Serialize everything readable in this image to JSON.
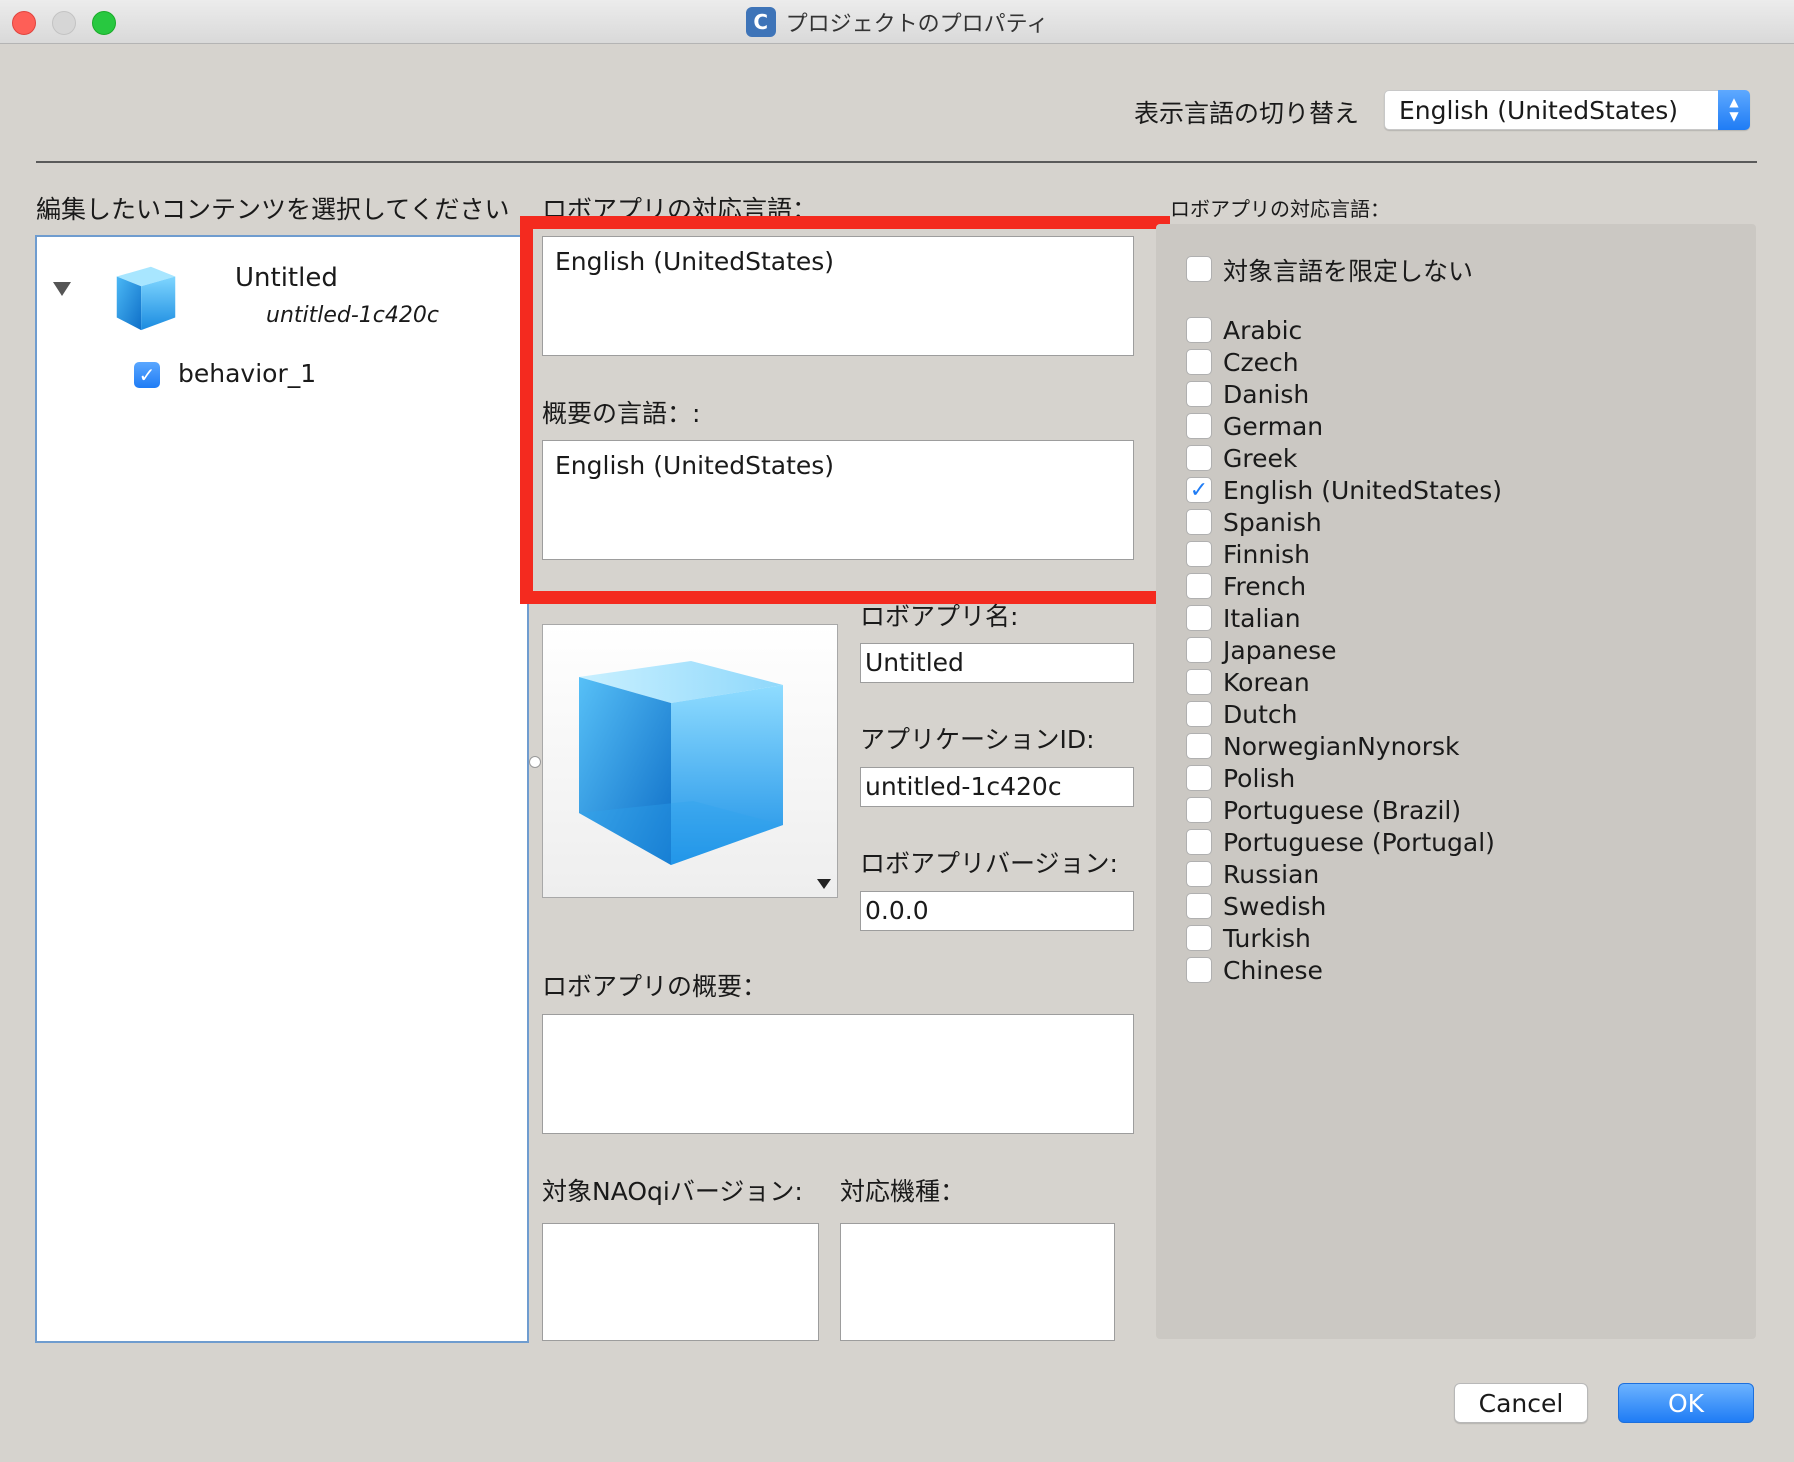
{
  "window": {
    "title": "プロジェクトのプロパティ",
    "app_icon_letter": "C"
  },
  "header": {
    "language_switch_label": "表示言語の切り替え",
    "language_switch_value": "English (UnitedStates)"
  },
  "tree": {
    "heading": "編集したいコンテンツを選択してください",
    "root_title": "Untitled",
    "root_subtitle": "untitled-1c420c",
    "child_label": "behavior_1",
    "child_checked": true
  },
  "details": {
    "supported_language_label": "ロボアプリの対応言語：",
    "supported_language_value": "English (UnitedStates)",
    "summary_language_label": "概要の言語：:",
    "summary_language_value": "English (UnitedStates)",
    "app_name_label": "ロボアプリ名:",
    "app_name_value": "Untitled",
    "app_id_label": "アプリケーションID:",
    "app_id_value": "untitled-1c420c",
    "version_label": "ロボアプリバージョン:",
    "version_value": "0.0.0",
    "description_label": "ロボアプリの概要：",
    "description_value": "",
    "naoqi_label": "対象NAOqiバージョン:",
    "naoqi_value": "",
    "models_label": "対応機種：",
    "models_value": ""
  },
  "languages": {
    "heading": "ロボアプリの対応言語：",
    "no_limit_label": "対象言語を限定しない",
    "no_limit_checked": false,
    "items": [
      {
        "label": "Arabic",
        "checked": false
      },
      {
        "label": "Czech",
        "checked": false
      },
      {
        "label": "Danish",
        "checked": false
      },
      {
        "label": "German",
        "checked": false
      },
      {
        "label": "Greek",
        "checked": false
      },
      {
        "label": "English (UnitedStates)",
        "checked": true
      },
      {
        "label": "Spanish",
        "checked": false
      },
      {
        "label": "Finnish",
        "checked": false
      },
      {
        "label": "French",
        "checked": false
      },
      {
        "label": "Italian",
        "checked": false
      },
      {
        "label": "Japanese",
        "checked": false
      },
      {
        "label": "Korean",
        "checked": false
      },
      {
        "label": "Dutch",
        "checked": false
      },
      {
        "label": "NorwegianNynorsk",
        "checked": false
      },
      {
        "label": "Polish",
        "checked": false
      },
      {
        "label": "Portuguese (Brazil)",
        "checked": false
      },
      {
        "label": "Portuguese (Portugal)",
        "checked": false
      },
      {
        "label": "Russian",
        "checked": false
      },
      {
        "label": "Swedish",
        "checked": false
      },
      {
        "label": "Turkish",
        "checked": false
      },
      {
        "label": "Chinese",
        "checked": false
      }
    ]
  },
  "buttons": {
    "cancel": "Cancel",
    "ok": "OK"
  },
  "colors": {
    "highlight": "#f42a1f",
    "accent": "#1f7cf5"
  },
  "icons": {
    "app_icon": "cube-icon"
  }
}
